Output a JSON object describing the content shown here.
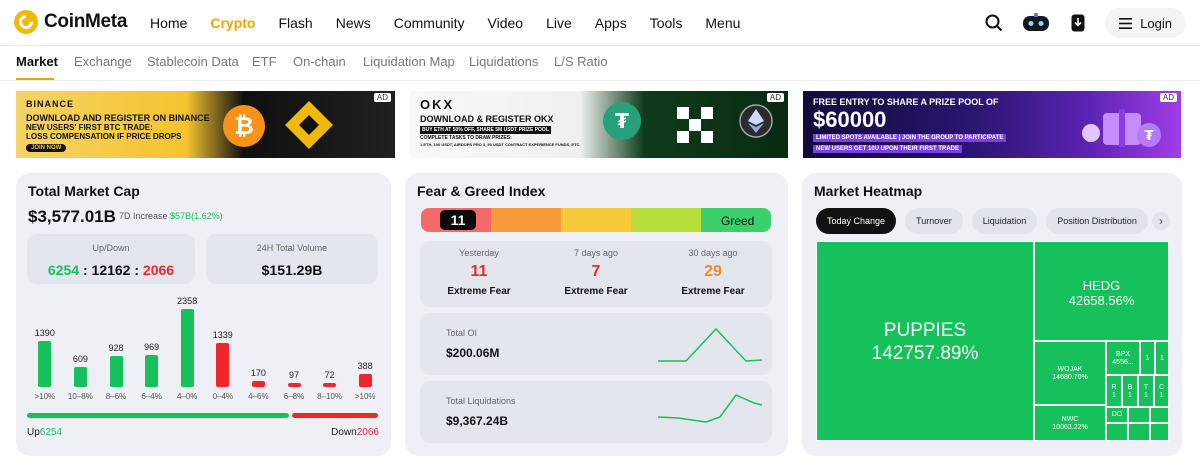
{
  "brand": {
    "name": "CoinMeta"
  },
  "nav": {
    "links": [
      "Home",
      "Crypto",
      "Flash",
      "News",
      "Community",
      "Video",
      "Live",
      "Apps",
      "Tools",
      "Menu"
    ],
    "active": "Crypto",
    "login": "Login"
  },
  "subnav": {
    "links": [
      "Market",
      "Exchange",
      "Stablecoin Data",
      "ETF",
      "On-chain",
      "Liquidation Map",
      "Liquidations",
      "L/S Ratio"
    ],
    "active": "Market"
  },
  "ads": [
    {
      "tag": "AD",
      "brand": "BINANCE",
      "lines": [
        "DOWNLOAD AND REGISTER ON BINANCE",
        "NEW USERS' FIRST BTC TRADE:",
        "LOSS COMPENSATION IF PRICE DROPS"
      ],
      "cta": "JOIN NOW"
    },
    {
      "tag": "AD",
      "brand": "OKX",
      "lines": [
        "DOWNLOAD & REGISTER OKX",
        "BUY ETH AT 50% OFF, SHARE 5M USDT PRIZE POOL",
        "COMPLETE TASKS TO DRAW PRIZES:",
        "1 ETH, 100 USDT, AIRDOPS PRO 3, 50 USDT CONTRACT EXPERIENCE FUNDS, ETC."
      ]
    },
    {
      "tag": "AD",
      "lines": [
        "FREE ENTRY TO SHARE A PRIZE POOL OF",
        "$60000",
        "LIMITED SPOTS AVAILABLE | JOIN THE GROUP TO PARTICIPATE",
        "NEW USERS GET 10U UPON THEIR FIRST TRADE"
      ]
    }
  ],
  "market_cap": {
    "title": "Total Market Cap",
    "value": "$3,577.01B",
    "change_label": "7D Increase",
    "change": "$57B(1.62%)",
    "updown": {
      "label": "Up/Down",
      "up": "6254",
      "flat": "12162",
      "down": "2066",
      "sep": ":"
    },
    "volume": {
      "label": "24H Total Volume",
      "value": "$151.29B"
    },
    "up_label": "Up",
    "down_label": "Down",
    "up_count": 6254,
    "down_count": 2066
  },
  "chart_data": {
    "type": "bar",
    "categories": [
      ">10%",
      "10–8%",
      "8–6%",
      "6–4%",
      "4–0%",
      "0–4%",
      "4–6%",
      "6–8%",
      "8–10%",
      ">10%"
    ],
    "values": [
      1390,
      609,
      928,
      969,
      2358,
      1339,
      170,
      97,
      72,
      388
    ],
    "colors": [
      "#16c05a",
      "#16c05a",
      "#16c05a",
      "#16c05a",
      "#16c05a",
      "#f0262d",
      "#f0262d",
      "#f0262d",
      "#f0262d",
      "#f0262d"
    ]
  },
  "fear_greed": {
    "title": "Fear & Greed Index",
    "value": "11",
    "label": "Greed",
    "colors": [
      "#f46a6a",
      "#f79a3a",
      "#f5c93a",
      "#b7dd3a",
      "#3dcf6a"
    ],
    "history": [
      {
        "label": "Yesterday",
        "value": "11",
        "status": "Extreme Fear",
        "color": "#f0262d"
      },
      {
        "label": "7 days ago",
        "value": "7",
        "status": "Extreme Fear",
        "color": "#f0262d"
      },
      {
        "label": "30 days ago",
        "value": "29",
        "status": "Extreme Fear",
        "color": "#f08a24"
      }
    ],
    "total_oi": {
      "label": "Total OI",
      "value": "$200.06M"
    },
    "total_liq": {
      "label": "Total Liquidations",
      "value": "$9,367.24B"
    }
  },
  "heatmap": {
    "title": "Market Heatmap",
    "tabs": [
      "Today Change",
      "Turnover",
      "Liquidation",
      "Position Distribution"
    ],
    "active_tab": "Today Change",
    "cells": [
      {
        "name": "PUPPIES",
        "value": "142757.89%"
      },
      {
        "name": "HEDG",
        "value": "42658.56%"
      },
      {
        "name": "WOJAK",
        "value": "14680.70%"
      },
      {
        "name": "NWC",
        "value": "10063.22%"
      },
      {
        "name": "BPX",
        "value": "4556..."
      },
      {
        "name": "1"
      },
      {
        "name": "1"
      },
      {
        "name": "R",
        "value": "1"
      },
      {
        "name": "B",
        "value": "1"
      },
      {
        "name": "T",
        "value": "1"
      },
      {
        "name": "C",
        "value": "1"
      },
      {
        "name": "DO"
      }
    ]
  }
}
